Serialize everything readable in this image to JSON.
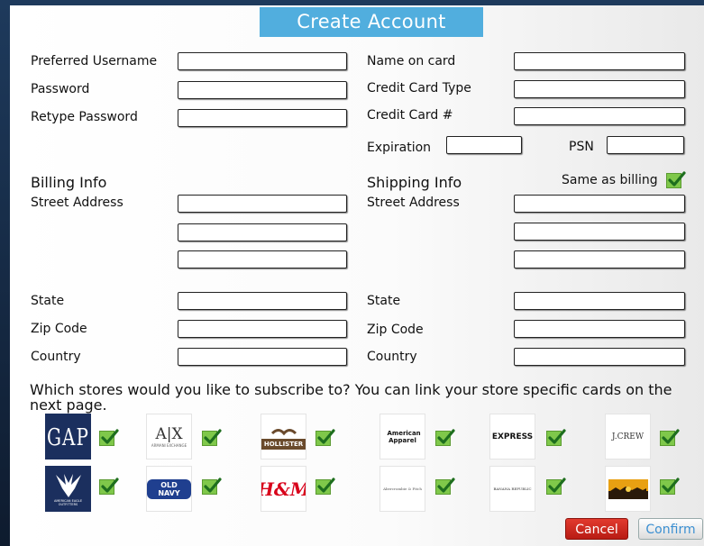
{
  "window": {
    "title": "Create Account"
  },
  "account": {
    "username_label": "Preferred Username",
    "password_label": "Password",
    "retype_label": "Retype Password"
  },
  "card": {
    "name_label": "Name on card",
    "type_label": "Credit Card Type",
    "number_label": "Credit Card #",
    "expiration_label": "Expiration",
    "psn_label": "PSN"
  },
  "billing": {
    "heading": "Billing Info",
    "street_label": "Street Address",
    "state_label": "State",
    "zip_label": "Zip Code",
    "country_label": "Country"
  },
  "shipping": {
    "heading": "Shipping Info",
    "same_label": "Same as billing",
    "same_checked": true,
    "street_label": "Street Address",
    "state_label": "State",
    "zip_label": "Zip Code",
    "country_label": "Country"
  },
  "stores": {
    "question": "Which stores would you like to subscribe to? You can link your store specific cards on the next page.",
    "items": [
      {
        "name": "GAP",
        "checked": true,
        "icon": "gap-logo"
      },
      {
        "name": "A|X",
        "sub": "ARMANI EXCHANGE",
        "checked": true,
        "icon": "armani-exchange-logo"
      },
      {
        "name": "HOLLISTER",
        "checked": true,
        "icon": "hollister-logo"
      },
      {
        "name": "American Apparel",
        "checked": true,
        "icon": "american-apparel-logo"
      },
      {
        "name": "EXPRESS",
        "checked": true,
        "icon": "express-logo"
      },
      {
        "name": "J.CREW",
        "checked": true,
        "icon": "jcrew-logo"
      },
      {
        "name": "AMERICAN EAGLE OUTFITTERS",
        "checked": true,
        "icon": "american-eagle-logo"
      },
      {
        "name": "OLD NAVY",
        "checked": true,
        "icon": "old-navy-logo"
      },
      {
        "name": "H&M",
        "checked": true,
        "icon": "hm-logo"
      },
      {
        "name": "Abercrombie & Fitch",
        "checked": true,
        "icon": "abercrombie-logo"
      },
      {
        "name": "BANANA REPUBLIC",
        "checked": true,
        "icon": "banana-republic-logo"
      },
      {
        "name": "",
        "checked": true,
        "icon": "sunset-store-logo"
      }
    ]
  },
  "actions": {
    "cancel": "Cancel",
    "confirm": "Confirm"
  },
  "colors": {
    "title_bar": "#51aede",
    "check_green": "#7fc84a",
    "cancel_red": "#d22a20",
    "confirm_text": "#3b8fd1",
    "gap_navy": "#1b2f5e",
    "old_navy_blue": "#1f3f8f",
    "hm_red": "#d8001a",
    "hollister_brown": "#6a4a2c"
  }
}
